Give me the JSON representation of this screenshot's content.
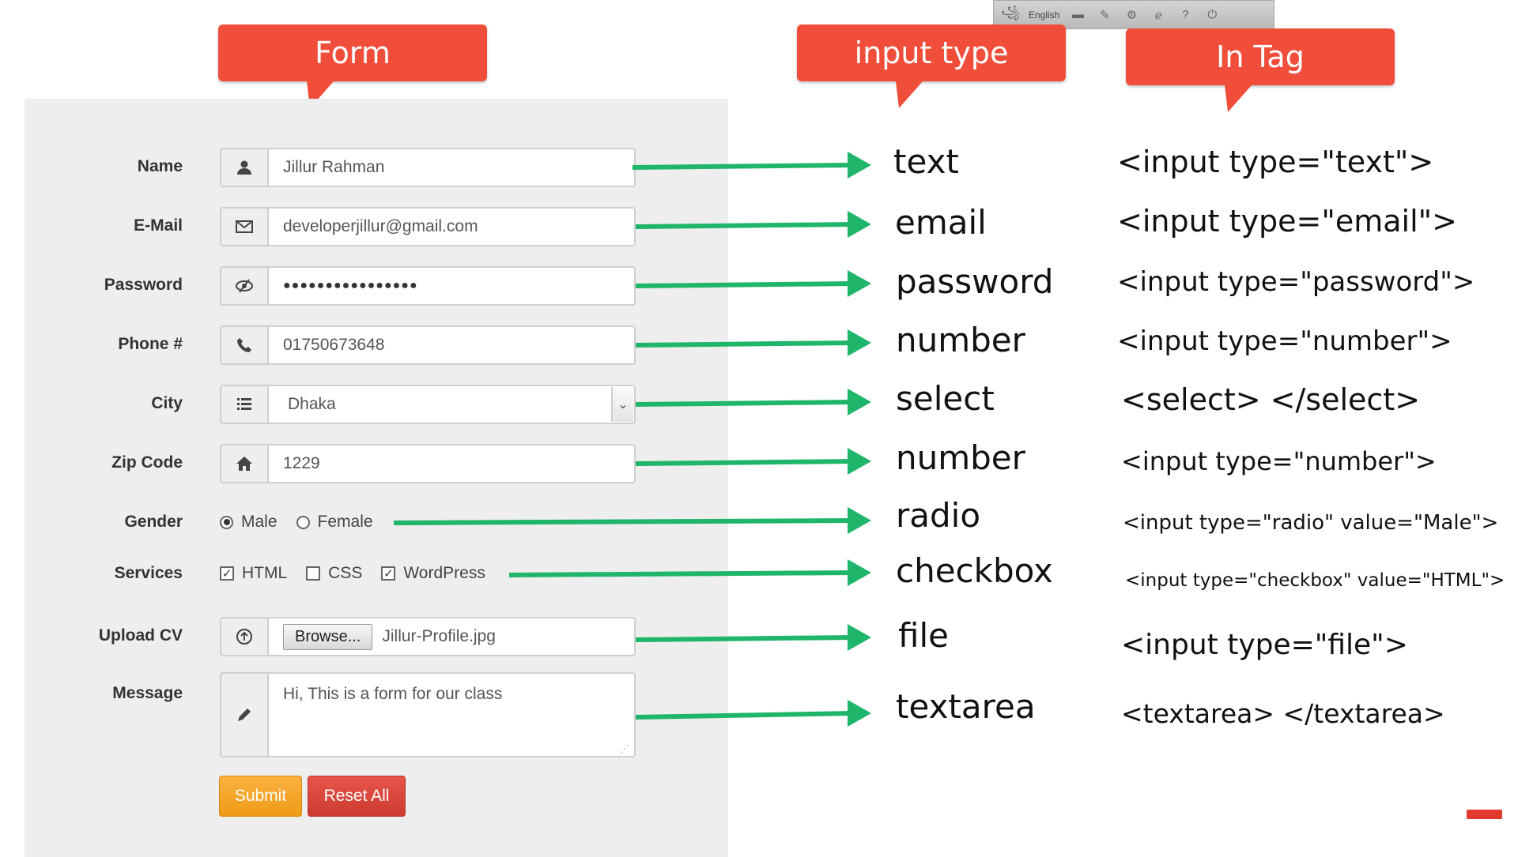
{
  "toolbar": {
    "language": "English",
    "icons": [
      "script-icon",
      "keyboard-icon",
      "pen-icon",
      "gear-icon",
      "browser-icon",
      "help-icon",
      "power-icon"
    ]
  },
  "callouts": {
    "form": "Form",
    "input_type": "input type",
    "in_tag": "In Tag"
  },
  "form": {
    "name": {
      "label": "Name",
      "value": "Jillur Rahman",
      "icon": "user-icon"
    },
    "email": {
      "label": "E-Mail",
      "value": "developerjillur@gmail.com",
      "icon": "envelope-icon"
    },
    "password": {
      "label": "Password",
      "value": "●●●●●●●●●●●●●●●●",
      "icon": "eye-slash-icon"
    },
    "phone": {
      "label": "Phone #",
      "value": "01750673648",
      "icon": "phone-icon"
    },
    "city": {
      "label": "City",
      "value": "Dhaka",
      "icon": "list-icon"
    },
    "zip": {
      "label": "Zip Code",
      "value": "1229",
      "icon": "home-icon"
    },
    "gender": {
      "label": "Gender",
      "options": [
        "Male",
        "Female"
      ],
      "selected": "Male"
    },
    "services": {
      "label": "Services",
      "options": [
        "HTML",
        "CSS",
        "WordPress"
      ],
      "checked": [
        "HTML",
        "WordPress"
      ]
    },
    "upload": {
      "label": "Upload CV",
      "browse_label": "Browse...",
      "filename": "Jillur-Profile.jpg",
      "icon": "upload-icon"
    },
    "message": {
      "label": "Message",
      "value": "Hi, This is a form for our class",
      "icon": "pencil-icon"
    },
    "submit_label": "Submit",
    "reset_label": "Reset All"
  },
  "input_types": [
    "text",
    "email",
    "password",
    "number",
    "select",
    "number",
    "radio",
    "checkbox",
    "file",
    "textarea"
  ],
  "tags": [
    "<input type=\"text\">",
    "<input type=\"email\">",
    "<input type=\"password\">",
    "<input type=\"number\">",
    "<select> </select>",
    "<input type=\"number\">",
    "<input type=\"radio\" value=\"Male\">",
    "<input type=\"checkbox\" value=\"HTML\">",
    "<input type=\"file\">",
    "<textarea> </textarea>"
  ],
  "colors": {
    "callout": "#f04e3b",
    "arrow": "#1fb56a",
    "submit": "#f3a21e",
    "reset": "#d5433a"
  }
}
